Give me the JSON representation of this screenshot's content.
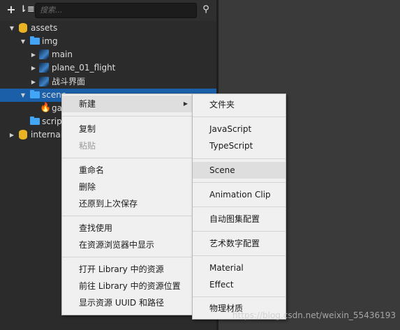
{
  "toolbar": {
    "add_icon": "plus-icon",
    "sort_icon": "sort-icon",
    "search_placeholder": "搜索...",
    "search_icon": "search-icon"
  },
  "tree": [
    {
      "label": "assets",
      "icon": "database-icon",
      "expanded": true
    },
    {
      "label": "img",
      "icon": "folder-icon",
      "expanded": true
    },
    {
      "label": "main",
      "icon": "image-icon",
      "expanded": false
    },
    {
      "label": "plane_01_flight",
      "icon": "image-icon",
      "expanded": false
    },
    {
      "label": "战斗界面",
      "icon": "image-icon",
      "expanded": false
    },
    {
      "label": "scene",
      "icon": "folder-icon",
      "expanded": true,
      "selected": true
    },
    {
      "label": "ga",
      "icon": "fire-icon"
    },
    {
      "label": "script",
      "icon": "folder-icon"
    },
    {
      "label": "internal",
      "icon": "database-icon",
      "expanded": false
    }
  ],
  "context_menu": [
    {
      "label": "新建",
      "has_submenu": true,
      "highlighted": true
    },
    {
      "label": "复制"
    },
    {
      "label": "粘贴",
      "disabled": true
    },
    {
      "label": "重命名"
    },
    {
      "label": "删除"
    },
    {
      "label": "还原到上次保存"
    },
    {
      "label": "查找使用"
    },
    {
      "label": "在资源浏览器中显示"
    },
    {
      "label": "打开 Library 中的资源"
    },
    {
      "label": "前往 Library 中的资源位置"
    },
    {
      "label": "显示资源 UUID 和路径"
    }
  ],
  "submenu": [
    {
      "label": "文件夹"
    },
    {
      "label": "JavaScript"
    },
    {
      "label": "TypeScript"
    },
    {
      "label": "Scene",
      "highlighted": true
    },
    {
      "label": "Animation Clip"
    },
    {
      "label": "自动图集配置"
    },
    {
      "label": "艺术数字配置"
    },
    {
      "label": "Material"
    },
    {
      "label": "Effect"
    },
    {
      "label": "物理材质"
    }
  ],
  "watermark": "https://blog.csdn.net/weixin_55436193"
}
